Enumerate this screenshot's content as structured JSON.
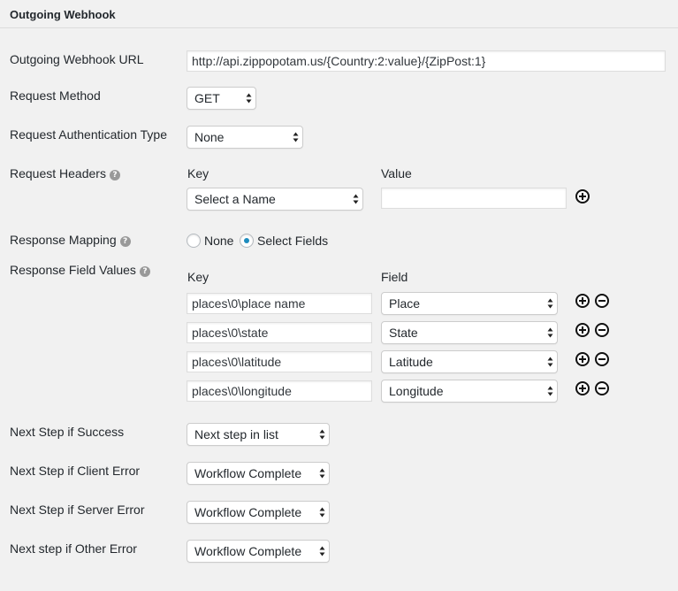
{
  "panel": {
    "title": "Outgoing Webhook"
  },
  "url": {
    "label": "Outgoing Webhook URL",
    "value": "http://api.zippopotam.us/{Country:2:value}/{ZipPost:1}"
  },
  "method": {
    "label": "Request Method",
    "value": "GET"
  },
  "auth": {
    "label": "Request Authentication Type",
    "value": "None"
  },
  "headers": {
    "label": "Request Headers",
    "key_heading": "Key",
    "value_heading": "Value",
    "key_select": "Select a Name",
    "value_input": ""
  },
  "mapping": {
    "label": "Response Mapping",
    "options": [
      "None",
      "Select Fields"
    ],
    "selected": "Select Fields"
  },
  "field_values": {
    "label": "Response Field Values",
    "key_heading": "Key",
    "field_heading": "Field",
    "rows": [
      {
        "key": "places\\0\\place name",
        "field": "Place"
      },
      {
        "key": "places\\0\\state",
        "field": "State"
      },
      {
        "key": "places\\0\\latitude",
        "field": "Latitude"
      },
      {
        "key": "places\\0\\longitude",
        "field": "Longitude"
      }
    ]
  },
  "next_steps": {
    "success": {
      "label": "Next Step if Success",
      "value": "Next step in list"
    },
    "client_error": {
      "label": "Next Step if Client Error",
      "value": "Workflow Complete"
    },
    "server_error": {
      "label": "Next Step if Server Error",
      "value": "Workflow Complete"
    },
    "other_error": {
      "label": "Next step if Other Error",
      "value": "Workflow Complete"
    }
  },
  "icons": {
    "help": "question-circle-icon",
    "add": "plus-circle-icon",
    "remove": "minus-circle-icon",
    "select_arrows": "up-down-arrows-icon"
  },
  "colors": {
    "background": "#f1f1f1",
    "radio_checked": "#1e8cbe"
  }
}
